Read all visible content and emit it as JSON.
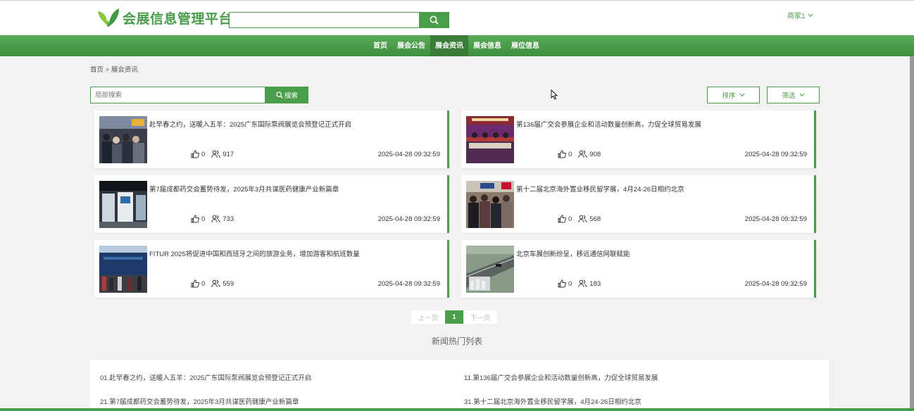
{
  "header": {
    "logo_text": "会展信息管理平台",
    "search_icon": "search-icon",
    "user": "商家1"
  },
  "nav": [
    "首页",
    "展会公告",
    "展会资讯",
    "展会信息",
    "展位信息"
  ],
  "nav_active": "展会资讯",
  "breadcrumb": "首页 > 展会资讯",
  "search": {
    "placeholder": "局部搜索",
    "button": "搜索"
  },
  "sort_label": "排序",
  "filter_label": "筛选",
  "articles": [
    {
      "title": "赴早春之约，送暖入五羊：2025广东国际泵阀展览会预登记正式开启",
      "likes": "0",
      "views": "917",
      "date": "2025-04-28 09:32:59"
    },
    {
      "title": "第136届广交会参展企业和活动数量创新高，力促全球贸易发展",
      "likes": "0",
      "views": "908",
      "date": "2025-04-28 09:32:59"
    },
    {
      "title": "第7届成都药交会蓄势待发，2025年3月共谋医药健康产业新篇章",
      "likes": "0",
      "views": "733",
      "date": "2025-04-28 09:32:59"
    },
    {
      "title": "第十二届北京海外置业移民留学展，4月24-26日相约北京",
      "likes": "0",
      "views": "568",
      "date": "2025-04-28 09:32:59"
    },
    {
      "title": "FITUR 2025将促进中国和西班牙之间的旅游业务，增加游客和航班数量",
      "likes": "0",
      "views": "559",
      "date": "2025-04-28 09:32:59"
    },
    {
      "title": "北京车展创新纷呈，移远通信网联赋能",
      "likes": "0",
      "views": "183",
      "date": "2025-04-28 09:32:59"
    }
  ],
  "pagination": {
    "prev": "上一页",
    "current": "1",
    "next": "下一页"
  },
  "hot_title": "新闻热门列表",
  "hot_list": [
    "01.赴早春之约，送暖入五羊：2025广东国际泵阀展览会预登记正式开启",
    "11.第136届广交会参展企业和活动数量创新高，力促全球贸易发展",
    "21.第7届成都药交会蓄势待发，2025年3月共谋医药健康产业新篇章",
    "31.第十二届北京海外置业移民留学展，4月24-26日相约北京"
  ],
  "colors": {
    "brand": "#4a9d4b",
    "nav_active": "#3a7d3a"
  }
}
